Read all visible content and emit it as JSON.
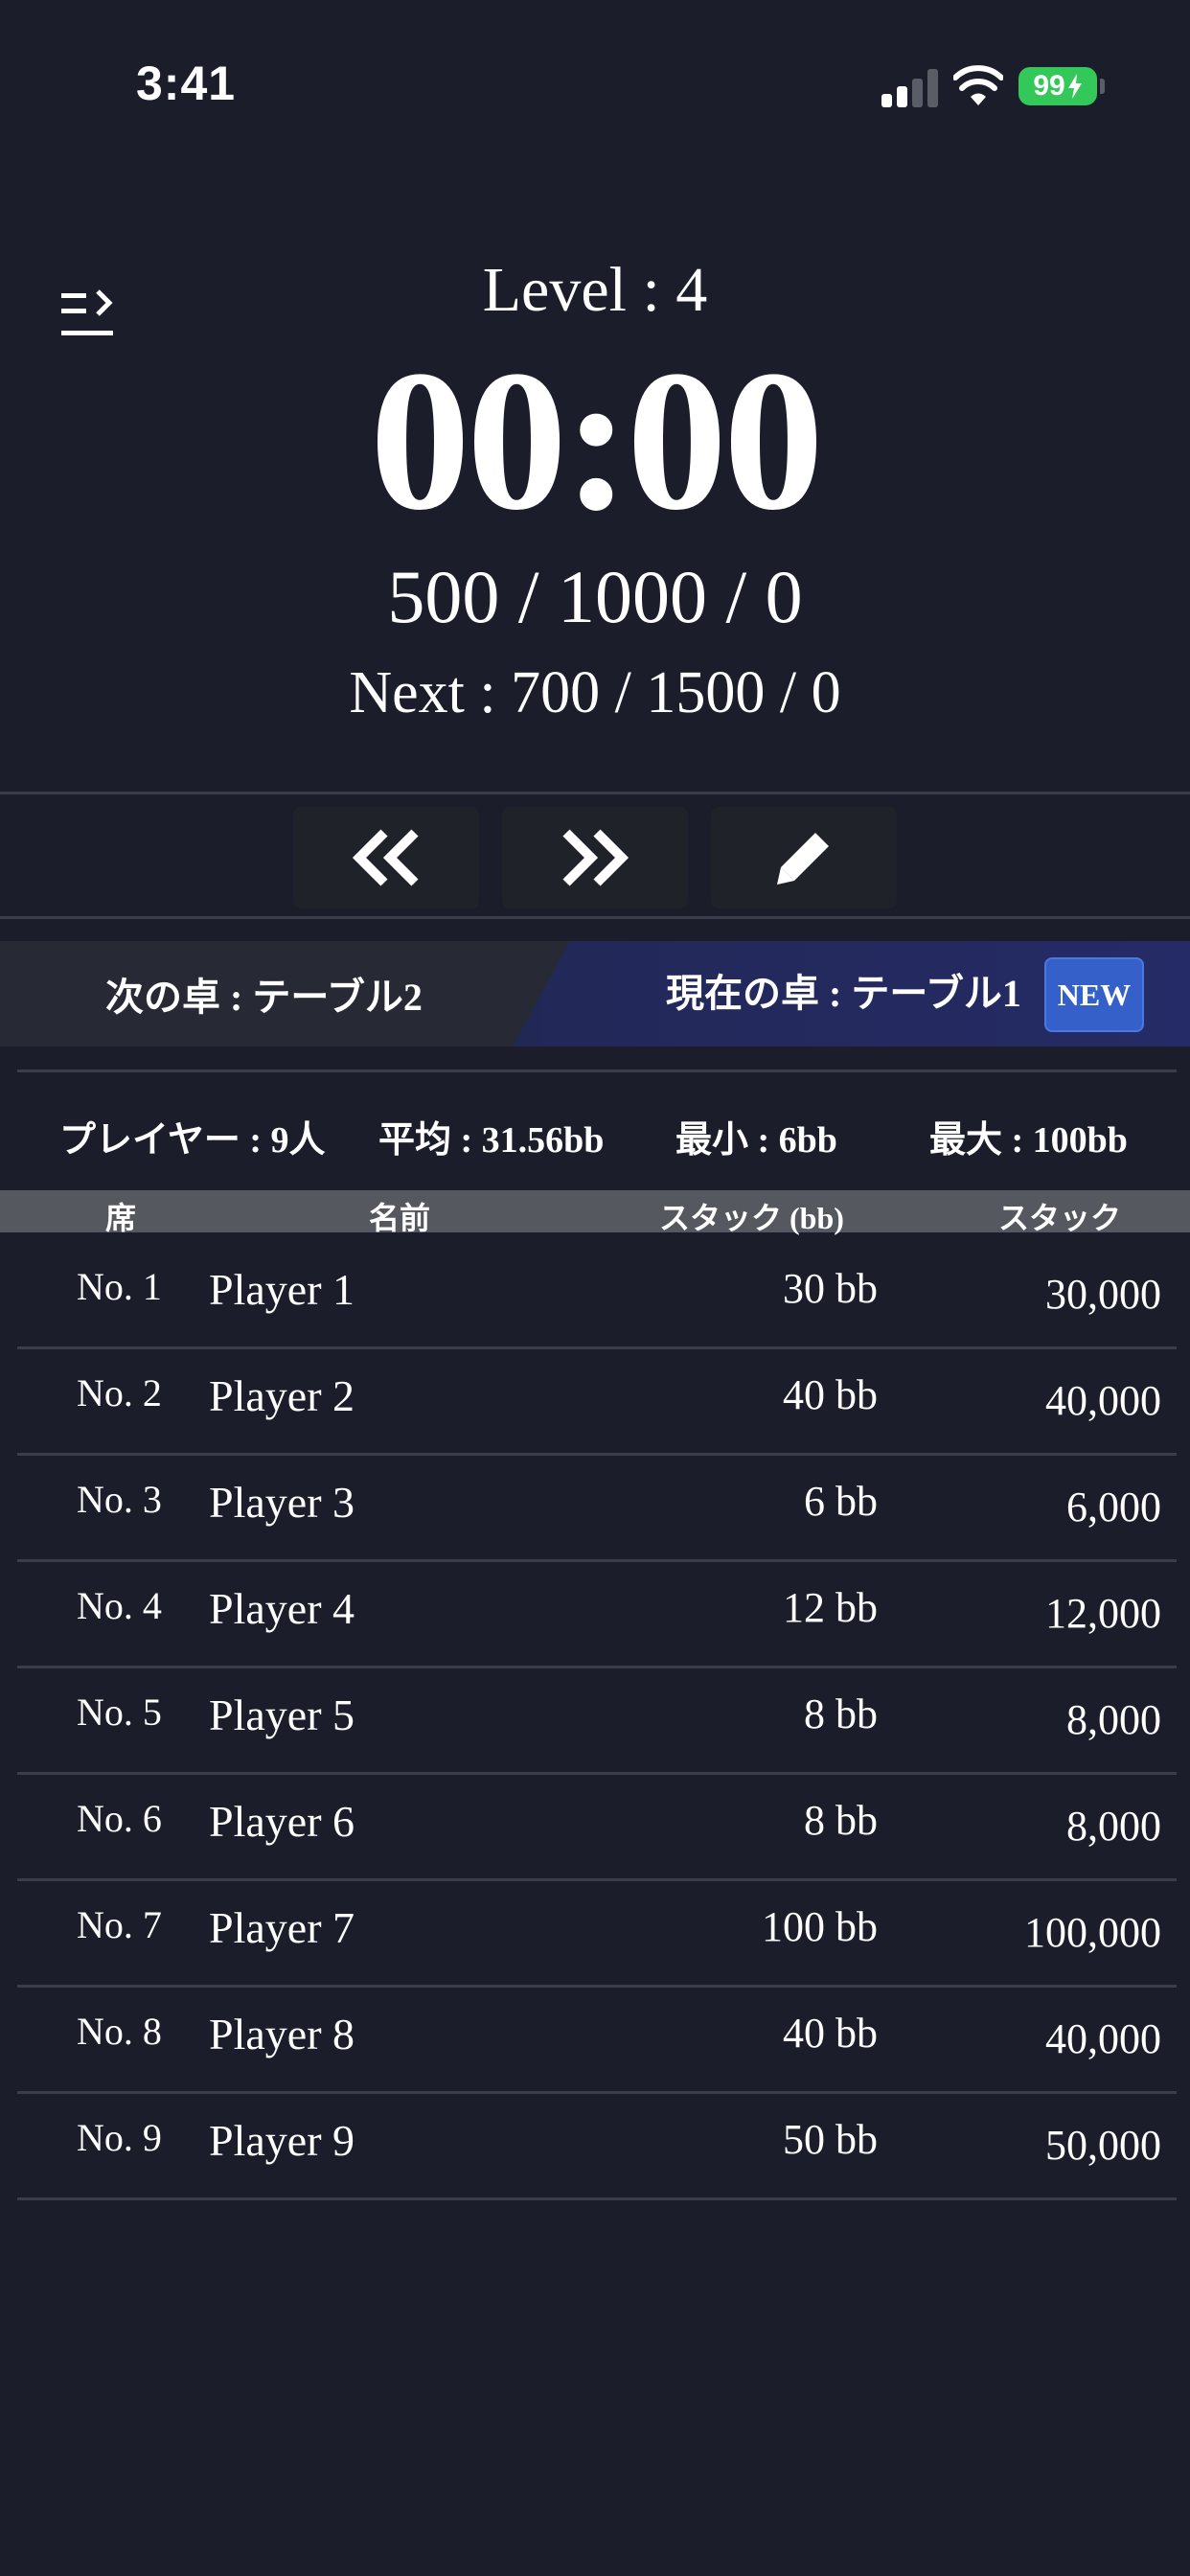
{
  "status_bar": {
    "time": "3:41",
    "battery": "99",
    "icons": [
      "cellular-signal-icon",
      "wifi-icon",
      "battery-charging-icon"
    ]
  },
  "header": {
    "level": "Level : 4",
    "timer": "00:00",
    "blinds": "500 / 1000 / 0",
    "next_blinds": "Next : 700 / 1500 / 0",
    "menu_icon": "menu-expand-icon"
  },
  "controls": {
    "prev_icon": "double-chevron-left-icon",
    "next_icon": "double-chevron-right-icon",
    "edit_icon": "pencil-icon"
  },
  "tabs": {
    "next_table": "次の卓 : テーブル2",
    "current_table": "現在の卓 : テーブル1",
    "new_badge": "NEW"
  },
  "stats": {
    "players": "プレイヤー : 9人",
    "average": "平均 : 31.56bb",
    "min": "最小 : 6bb",
    "max": "最大 : 100bb"
  },
  "table": {
    "headers": {
      "seat": "席",
      "name": "名前",
      "stack_bb": "スタック (bb)",
      "stack": "スタック"
    },
    "rows": [
      {
        "seat": "No. 1",
        "name": "Player 1",
        "bb": "30 bb",
        "stack": "30,000"
      },
      {
        "seat": "No. 2",
        "name": "Player 2",
        "bb": "40 bb",
        "stack": "40,000"
      },
      {
        "seat": "No. 3",
        "name": "Player 3",
        "bb": "6 bb",
        "stack": "6,000"
      },
      {
        "seat": "No. 4",
        "name": "Player 4",
        "bb": "12 bb",
        "stack": "12,000"
      },
      {
        "seat": "No. 5",
        "name": "Player 5",
        "bb": "8 bb",
        "stack": "8,000"
      },
      {
        "seat": "No. 6",
        "name": "Player 6",
        "bb": "8 bb",
        "stack": "8,000"
      },
      {
        "seat": "No. 7",
        "name": "Player 7",
        "bb": "100 bb",
        "stack": "100,000"
      },
      {
        "seat": "No. 8",
        "name": "Player 8",
        "bb": "40 bb",
        "stack": "40,000"
      },
      {
        "seat": "No. 9",
        "name": "Player 9",
        "bb": "50 bb",
        "stack": "50,000"
      }
    ]
  },
  "colors": {
    "background": "#1b1d2a",
    "accent": "#3560c9",
    "battery": "#34c759"
  }
}
